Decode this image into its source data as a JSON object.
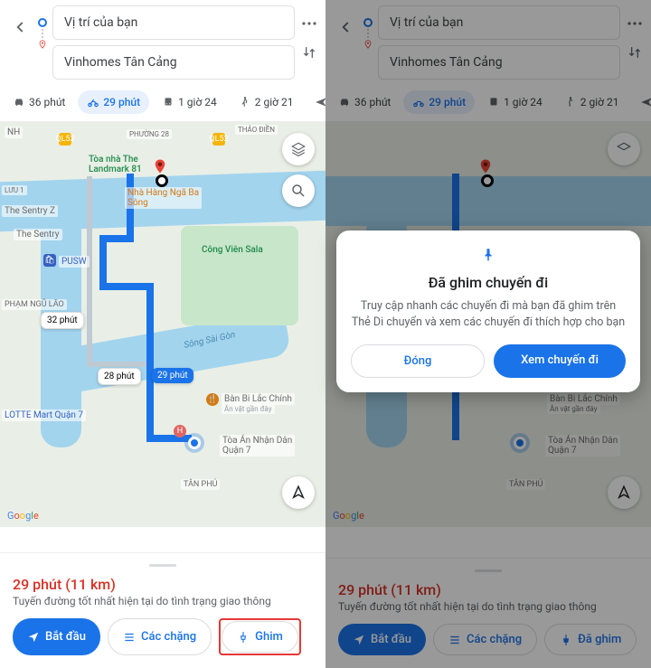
{
  "origin": "Vị trí của bạn",
  "destination": "Vinhomes Tân Cảng",
  "modes": {
    "car": "36 phút",
    "motorbike": "29 phút",
    "transit": "1 giờ 24",
    "walk": "2 giờ 21",
    "plane": "—"
  },
  "map": {
    "badge_alt1": "32 phút",
    "badge_alt2": "28 phút",
    "badge_main": "29 phút",
    "landmark": "Tòa nhà The\nLandmark 81",
    "restaurant": "Nhà Hàng Ngã Ba\nSông",
    "park": "Công Viên Sala",
    "pusw": "PUSW",
    "street1": "PHẠM NGŨ LÃO",
    "sentry": "The Sentry",
    "sentryz": "The Sentry Z",
    "lotte": "LOTTE Mart Quận 7",
    "river": "Sông Sài Gòn",
    "poi1": "Bàn Bi Lắc Chính",
    "poi1sub": "Ăn vặt gần đây",
    "poi2": "Tòa Án Nhận Dân\nQuận 7",
    "tanphu": "TÂN PHÚ",
    "thaodien": "THẢO ĐIỀN",
    "luu1": "LƯU 1",
    "ql52a": "QL52",
    "ql52b": "QL52",
    "phuong28": "PHƯỜNG 28",
    "watermark": "Google"
  },
  "sheet": {
    "time": "29 phút",
    "distance": "(11 km)",
    "subtitle": "Tuyến đường tốt nhất hiện tại do tình trạng giao thông",
    "start": "Bắt đầu",
    "steps": "Các chặng",
    "pin": "Ghim",
    "pinned": "Đã ghim"
  },
  "dialog": {
    "title": "Đã ghim chuyến đi",
    "body": "Truy cập nhanh các chuyến đi mà bạn đã ghim trên Thẻ Di chuyển và xem các chuyến đi thích hợp cho bạn",
    "close": "Đóng",
    "view": "Xem chuyến đi"
  }
}
